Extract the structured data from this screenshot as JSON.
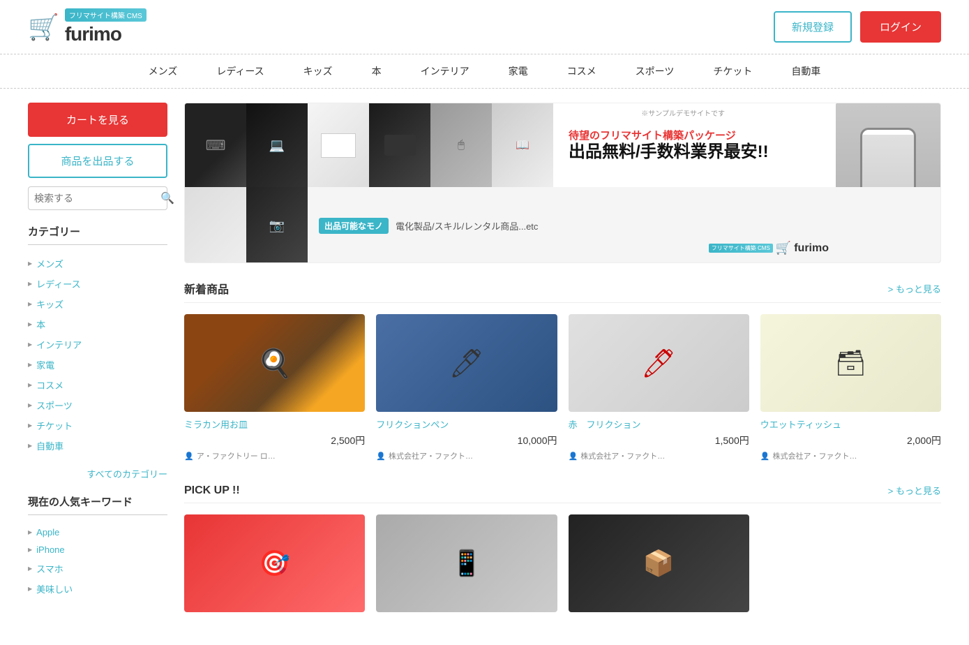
{
  "header": {
    "logo_badge": "フリマサイト構築 CMS",
    "logo_name": "furimo",
    "btn_register": "新規登録",
    "btn_login": "ログイン"
  },
  "nav": {
    "items": [
      {
        "label": "メンズ"
      },
      {
        "label": "レディース"
      },
      {
        "label": "キッズ"
      },
      {
        "label": "本"
      },
      {
        "label": "インテリア"
      },
      {
        "label": "家電"
      },
      {
        "label": "コスメ"
      },
      {
        "label": "スポーツ"
      },
      {
        "label": "チケット"
      },
      {
        "label": "自動車"
      }
    ]
  },
  "sidebar": {
    "btn_cart": "カートを見る",
    "btn_sell": "商品を出品する",
    "search_placeholder": "検索する",
    "category_title": "カテゴリー",
    "categories": [
      {
        "label": "メンズ"
      },
      {
        "label": "レディース"
      },
      {
        "label": "キッズ"
      },
      {
        "label": "本"
      },
      {
        "label": "インテリア"
      },
      {
        "label": "家電"
      },
      {
        "label": "コスメ"
      },
      {
        "label": "スポーツ"
      },
      {
        "label": "チケット"
      },
      {
        "label": "自動車"
      }
    ],
    "all_categories_link": "すべてのカテゴリー",
    "popular_keywords_title": "現在の人気キーワード",
    "keywords": [
      {
        "label": "Apple"
      },
      {
        "label": "iPhone"
      },
      {
        "label": "スマホ"
      },
      {
        "label": "美味しい"
      }
    ]
  },
  "banner": {
    "note": "※サンプルデモサイトです",
    "subtitle": "待望のフリマサイト構築パッケージ",
    "title": "出品無料/手数料業界最安!!",
    "badge": "出品可能なモノ",
    "bottom_text": "電化製品/スキル/レンタル商品...etc",
    "logo_badge": "フリマサイト構築 CMS",
    "logo_name": "furimo"
  },
  "new_items": {
    "title": "新着商品",
    "more_link": "> もっと見る",
    "products": [
      {
        "name": "ミラカン用お皿",
        "price": "2,500円",
        "seller": "ア・ファクトリー ロ…"
      },
      {
        "name": "フリクションペン",
        "price": "10,000円",
        "seller": "株式会社ア・ファクト…"
      },
      {
        "name": "赤　フリクション",
        "price": "1,500円",
        "seller": "株式会社ア・ファクト…"
      },
      {
        "name": "ウエットティッシュ",
        "price": "2,000円",
        "seller": "株式会社ア・ファクト…"
      }
    ]
  },
  "pickup": {
    "title": "PICK UP !!",
    "more_link": "> もっと見る"
  }
}
